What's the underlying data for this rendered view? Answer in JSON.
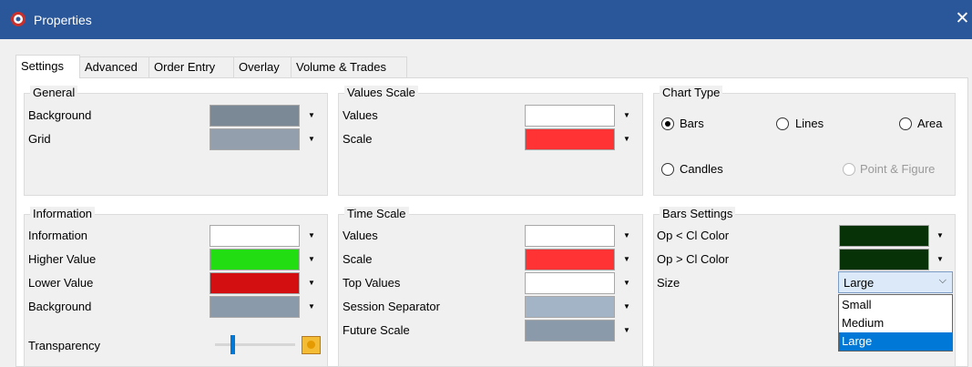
{
  "window": {
    "title": "Properties",
    "app_icon": "app-icon",
    "close_label": "✕"
  },
  "tabs": [
    {
      "label": "Settings",
      "active": true
    },
    {
      "label": "Advanced",
      "active": false
    },
    {
      "label": "Order Entry",
      "active": false
    },
    {
      "label": "Overlay",
      "active": false
    },
    {
      "label": "Volume & Trades",
      "active": false
    }
  ],
  "general": {
    "title": "General",
    "rows": [
      {
        "label": "Background",
        "color": "#7b8896"
      },
      {
        "label": "Grid",
        "color": "#939fac"
      }
    ]
  },
  "values_scale": {
    "title": "Values Scale",
    "rows": [
      {
        "label": "Values",
        "color": "#ffffff"
      },
      {
        "label": "Scale",
        "color": "#ff3333"
      }
    ]
  },
  "chart_type": {
    "title": "Chart Type",
    "options": [
      {
        "label": "Bars",
        "checked": true,
        "enabled": true
      },
      {
        "label": "Lines",
        "checked": false,
        "enabled": true
      },
      {
        "label": "Area",
        "checked": false,
        "enabled": true
      },
      {
        "label": "Candles",
        "checked": false,
        "enabled": true
      },
      {
        "label": "Point & Figure",
        "checked": false,
        "enabled": false
      }
    ]
  },
  "information": {
    "title": "Information",
    "rows": [
      {
        "label": "Information",
        "color": "#ffffff"
      },
      {
        "label": "Higher Value",
        "color": "#22dd11"
      },
      {
        "label": "Lower Value",
        "color": "#d40f12"
      },
      {
        "label": "Background",
        "color": "#8a9aaa"
      }
    ],
    "transparency_label": "Transparency",
    "transparency_level": 0.2
  },
  "time_scale": {
    "title": "Time Scale",
    "rows": [
      {
        "label": "Values",
        "color": "#ffffff"
      },
      {
        "label": "Scale",
        "color": "#ff3333"
      },
      {
        "label": "Top Values",
        "color": "#ffffff"
      },
      {
        "label": "Session Separator",
        "color": "#a3b4c7"
      },
      {
        "label": "Future Scale",
        "color": "#8a9aaa"
      }
    ]
  },
  "bars_settings": {
    "title": "Bars Settings",
    "rows": [
      {
        "label": "Op < Cl Color",
        "color": "#073207"
      },
      {
        "label": "Op > Cl Color",
        "color": "#073207"
      }
    ],
    "size_label": "Size",
    "size_value": "Large",
    "size_options": [
      "Small",
      "Medium",
      "Large"
    ],
    "size_selected_index": 2
  },
  "icons": {
    "dropdown_arrow": "▼",
    "select_chevron": "⌵"
  },
  "colors": {
    "titlebar": "#2a579a",
    "selection": "#0078d7"
  }
}
